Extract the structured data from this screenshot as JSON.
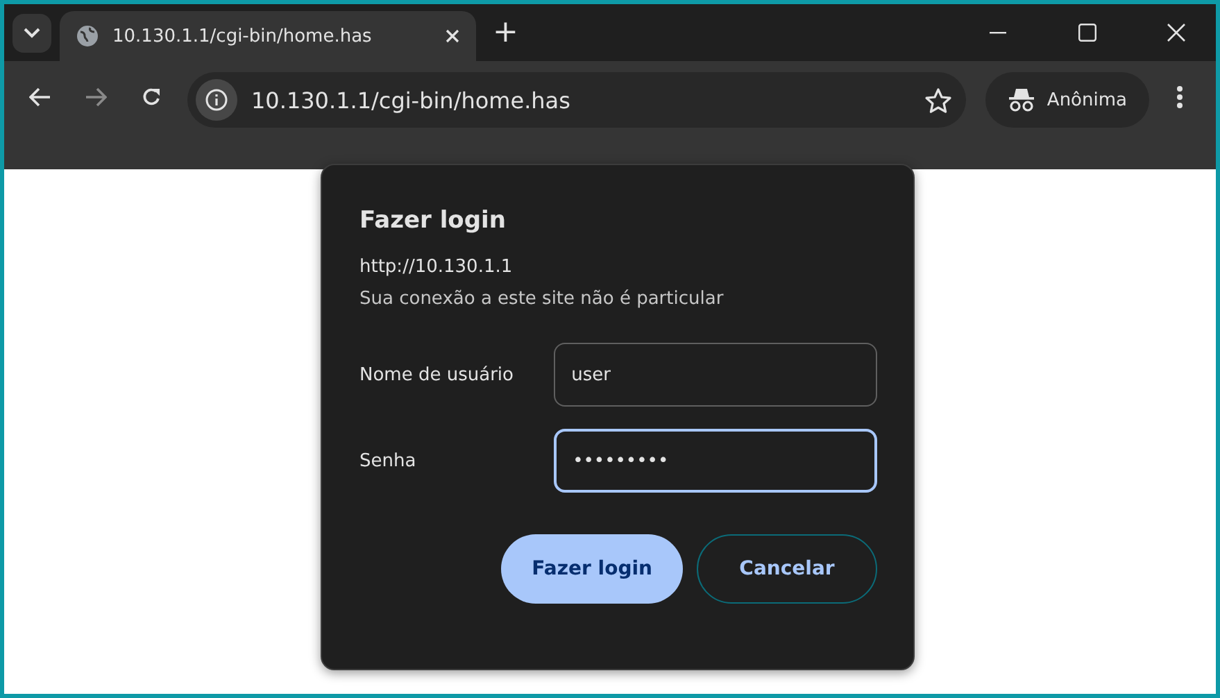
{
  "tab_strip": {
    "tabs": [
      {
        "title": "10.130.1.1/cgi-bin/home.has",
        "selected": true
      }
    ],
    "new_tab": "+"
  },
  "toolbar": {
    "address": "10.130.1.1/cgi-bin/home.has",
    "profile": "Anônima"
  },
  "dialog": {
    "title": "Fazer login",
    "origin": "http://10.130.1.1",
    "warning": "Sua conexão a este site não é particular",
    "fields": [
      {
        "label": "Nome de usuário",
        "value": "user",
        "focused": false
      },
      {
        "label": "Senha",
        "value": "•••••••••",
        "focused": true
      }
    ],
    "buttons": [
      {
        "label": "Fazer login",
        "kind": "primary"
      },
      {
        "label": "Cancelar",
        "kind": "secondary"
      }
    ]
  }
}
